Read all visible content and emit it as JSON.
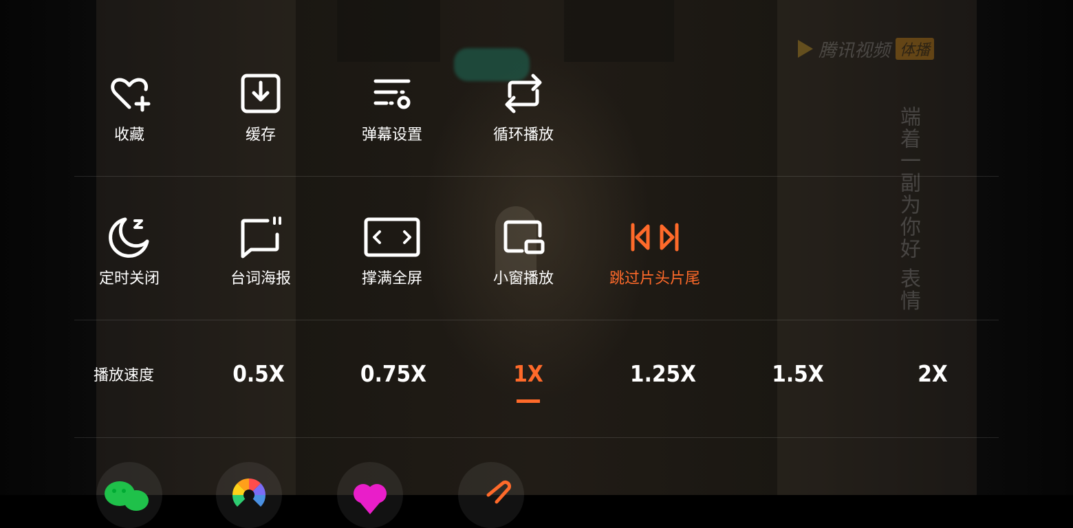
{
  "watermark": {
    "brand": "腾讯视频",
    "tag": "体播"
  },
  "subtitle_vertical": "端着一副为你好 表情",
  "row1": [
    {
      "label": "收藏",
      "icon": "heart-plus-icon"
    },
    {
      "label": "缓存",
      "icon": "download-icon"
    },
    {
      "label": "弹幕设置",
      "icon": "danmaku-settings-icon"
    },
    {
      "label": "循环播放",
      "icon": "loop-icon"
    }
  ],
  "row2": [
    {
      "label": "定时关闭",
      "icon": "sleep-timer-icon"
    },
    {
      "label": "台词海报",
      "icon": "quote-poster-icon"
    },
    {
      "label": "撑满全屏",
      "icon": "stretch-screen-icon"
    },
    {
      "label": "小窗播放",
      "icon": "picture-in-picture-icon"
    },
    {
      "label": "跳过片头片尾",
      "icon": "skip-intro-outro-icon",
      "active": true
    }
  ],
  "speed": {
    "label": "播放速度",
    "options": [
      "0.5X",
      "0.75X",
      "1X",
      "1.25X",
      "1.5X",
      "2X"
    ],
    "selected": "1X"
  },
  "share_icons": [
    "wechat-icon",
    "moments-icon",
    "qq-icon",
    "more-share-icon"
  ],
  "colors": {
    "accent": "#ff6a2a",
    "text": "#ffffff",
    "divider": "rgba(255,255,255,0.12)"
  }
}
